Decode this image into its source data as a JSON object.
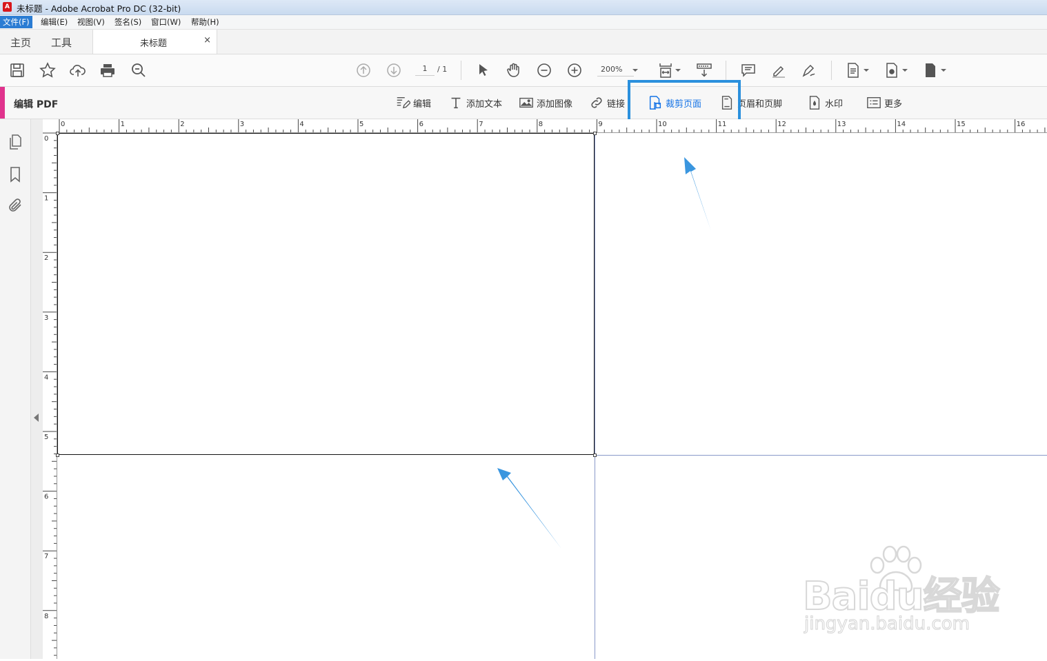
{
  "window": {
    "title": "未标题 - Adobe Acrobat Pro DC (32-bit)",
    "logo": "A"
  },
  "menu": [
    "文件(F)",
    "编辑(E)",
    "视图(V)",
    "签名(S)",
    "窗口(W)",
    "帮助(H)"
  ],
  "nav_tabs": [
    "主页",
    "工具"
  ],
  "doc_tab": {
    "label": "未标题",
    "close": "×"
  },
  "toolbar": {
    "page_current": "1",
    "page_total": "/ 1",
    "zoom": "200%",
    "icons": [
      "save-icon",
      "star-icon",
      "cloud-upload-icon",
      "print-icon",
      "search-zoom-icon",
      "page-up-icon",
      "page-down-icon",
      "select-cursor-icon",
      "hand-icon",
      "zoom-out-icon",
      "zoom-in-icon",
      "fit-page-icon",
      "scroll-mode-icon",
      "comment-icon",
      "highlight-icon",
      "sign-icon",
      "page-tools-icon",
      "export-icon",
      "more-page-icon"
    ]
  },
  "edit_toolbar": {
    "title": "编辑 PDF",
    "buttons": [
      {
        "label": "编辑"
      },
      {
        "label": "添加文本"
      },
      {
        "label": "添加图像"
      },
      {
        "label": "链接"
      },
      {
        "label": "裁剪页面"
      },
      {
        "label": "页眉和页脚"
      },
      {
        "label": "水印"
      },
      {
        "label": "更多"
      }
    ]
  },
  "rulers": {
    "horizontal": [
      "0",
      "1",
      "2",
      "3",
      "4",
      "5",
      "6",
      "7",
      "8",
      "9",
      "10",
      "11",
      "12",
      "13",
      "14",
      "15",
      "16"
    ],
    "vertical": [
      "0",
      "1",
      "2",
      "3",
      "4",
      "5",
      "6",
      "7",
      "8"
    ]
  },
  "watermark": {
    "line1": "Baidu经验",
    "line2": "jingyan.baidu.com"
  },
  "colors": {
    "accent": "#1473e6",
    "highlight_box": "#2b90dd",
    "arrow": "#3a96df",
    "edit_bar": "#e0338d"
  }
}
